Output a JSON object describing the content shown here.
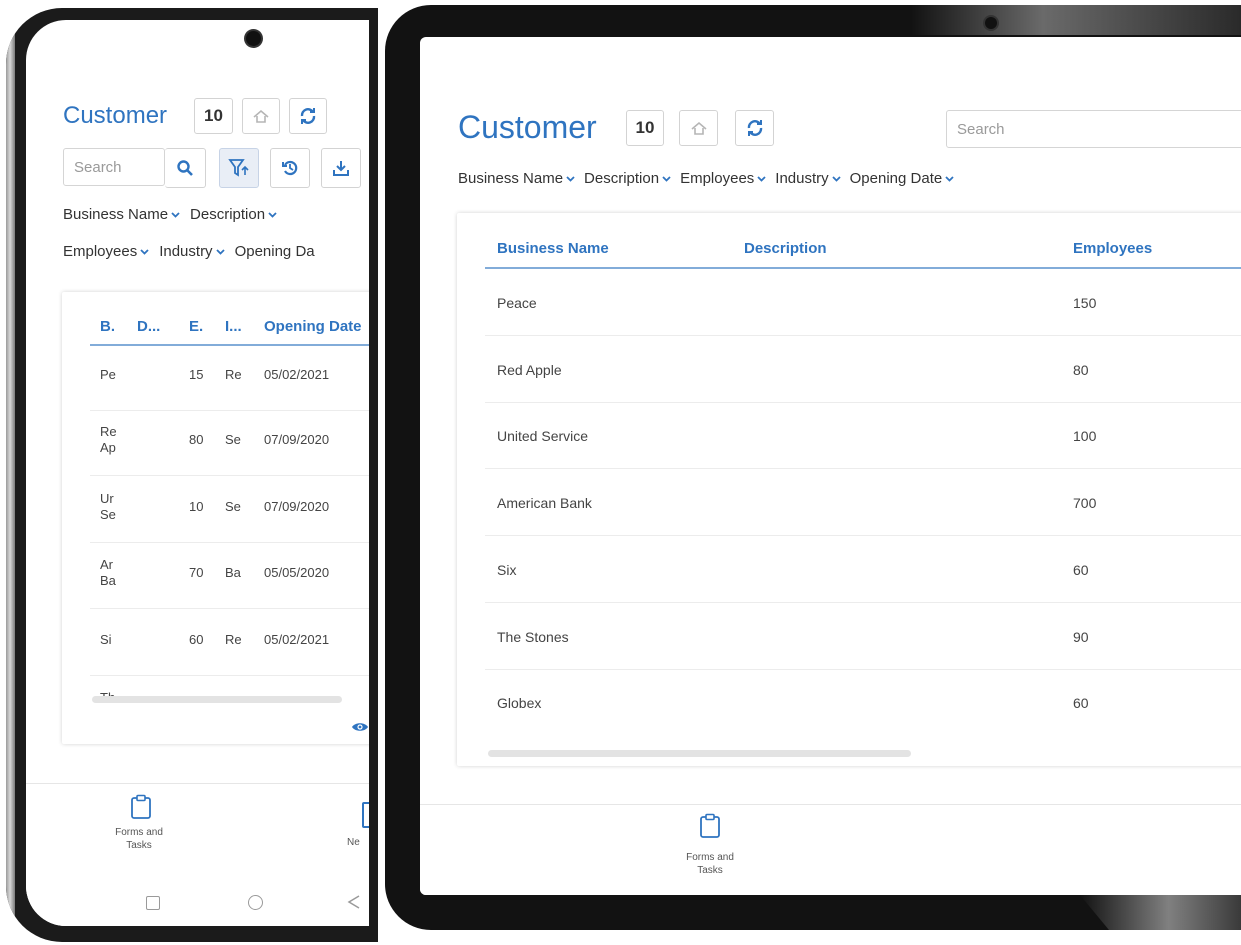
{
  "phone": {
    "title": "Customer",
    "count": "10",
    "search": {
      "placeholder": "Search"
    },
    "columns": [
      "Business Name",
      "Description",
      "Employees",
      "Industry",
      "Opening Da"
    ],
    "table": {
      "headers": [
        "B.",
        "D...",
        "E.",
        "I...",
        "Opening Date"
      ],
      "rows": [
        {
          "name": "Pe",
          "name2": "",
          "emp": "15",
          "ind": "Re",
          "date": "05/02/2021"
        },
        {
          "name": "Re",
          "name2": "Ap",
          "emp": "80",
          "ind": "Se",
          "date": "07/09/2020"
        },
        {
          "name": "Ur",
          "name2": "Se",
          "emp": "10",
          "ind": "Se",
          "date": "07/09/2020"
        },
        {
          "name": "Ar",
          "name2": "Ba",
          "emp": "70",
          "ind": "Ba",
          "date": "05/05/2020"
        },
        {
          "name": "Si",
          "name2": "",
          "emp": "60",
          "ind": "Re",
          "date": "05/02/2021"
        },
        {
          "name": "Th",
          "name2": "",
          "emp": "",
          "ind": "",
          "date": ""
        }
      ]
    },
    "nav": {
      "forms_line1": "Forms and",
      "forms_line2": "Tasks",
      "news": "Ne"
    }
  },
  "tablet": {
    "title": "Customer",
    "count": "10",
    "search": {
      "placeholder": "Search"
    },
    "columns": [
      "Business Name",
      "Description",
      "Employees",
      "Industry",
      "Opening Date"
    ],
    "table": {
      "headers": [
        "Business Name",
        "Description",
        "Employees"
      ],
      "rows": [
        {
          "name": "Peace",
          "employees": "150"
        },
        {
          "name": "Red Apple",
          "employees": "80"
        },
        {
          "name": "United Service",
          "employees": "100"
        },
        {
          "name": "American Bank",
          "employees": "700"
        },
        {
          "name": "Six",
          "employees": "60"
        },
        {
          "name": "The Stones",
          "employees": "90"
        },
        {
          "name": "Globex",
          "employees": "60"
        }
      ]
    },
    "nav": {
      "forms_line1": "Forms and",
      "forms_line2": "Tasks"
    }
  },
  "colors": {
    "accent": "#2f74c0",
    "text": "#333333",
    "border": "#d3d3d3"
  }
}
